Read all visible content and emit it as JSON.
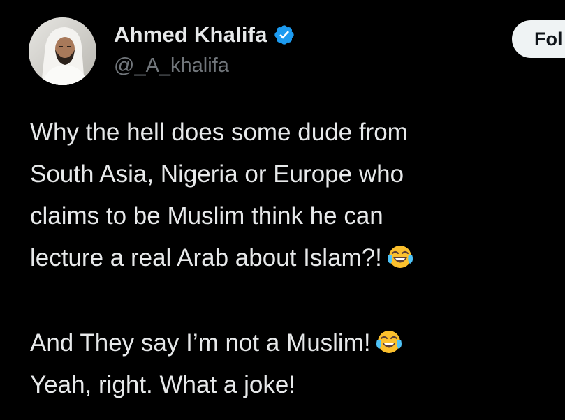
{
  "author": {
    "display_name": "Ahmed Khalifa",
    "handle": "@_A_khalifa",
    "verified_icon": "verified-badge-icon",
    "avatar": "profile-photo"
  },
  "follow_button": {
    "label": "Fol"
  },
  "tweet": {
    "lines": [
      "Why the hell does some dude from",
      "South Asia, Nigeria or Europe who",
      "claims to be Muslim think he can",
      "lecture a real Arab about Islam?!",
      "And They say I’m not a Muslim!",
      "Yeah, right. What a joke!"
    ],
    "emoji": "face-with-tears-of-joy"
  },
  "colors": {
    "background": "#000000",
    "primary_text": "#e7e9ea",
    "secondary_text": "#71767b",
    "verified_blue": "#1d9bf0",
    "button_bg": "#eff3f4"
  }
}
